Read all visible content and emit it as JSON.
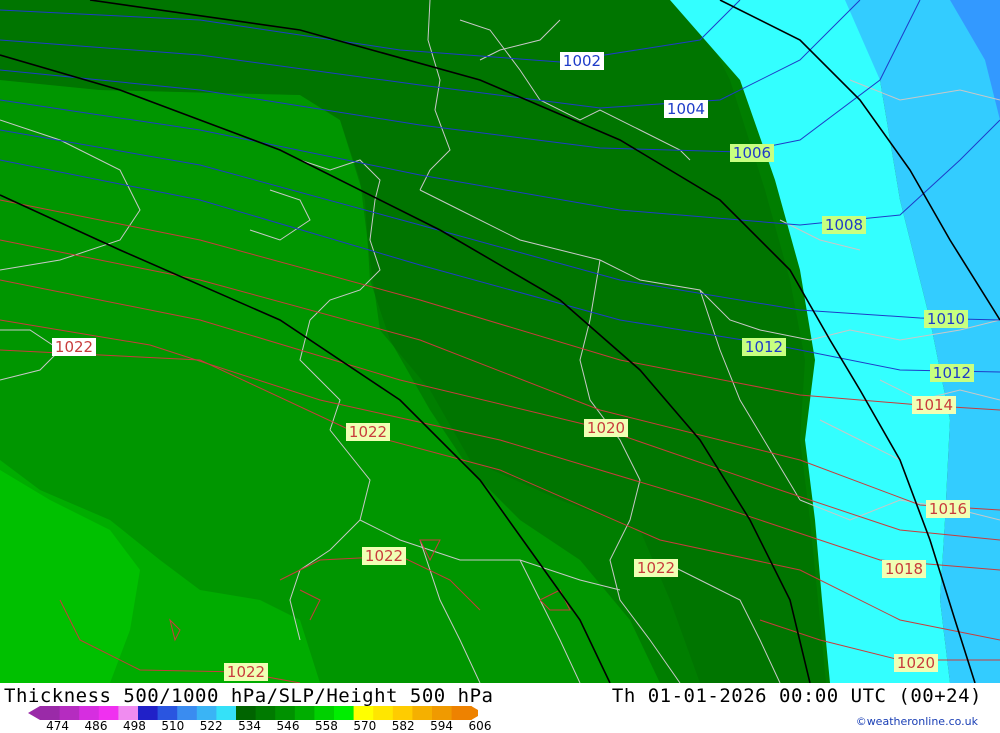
{
  "header": {
    "title": "Thickness 500/1000 hPa/SLP/Height 500 hPa",
    "valid_time": "Th 01-01-2026 00:00 UTC (00+24)",
    "credit": "©weatheronline.co.uk"
  },
  "legend": {
    "ticks": [
      "474",
      "486",
      "498",
      "510",
      "522",
      "534",
      "546",
      "558",
      "570",
      "582",
      "594",
      "606"
    ],
    "colors": [
      "#9a2aa8",
      "#b52cc0",
      "#d62ee0",
      "#f030f0",
      "#f08cf0",
      "#2020c8",
      "#2a55e0",
      "#3a8cf0",
      "#3ab4f5",
      "#35e1f8",
      "#006400",
      "#007a00",
      "#009100",
      "#00ad00",
      "#00d000",
      "#00ee00",
      "#ffff00",
      "#ffe600",
      "#ffcc00",
      "#f5b000",
      "#f09a00",
      "#ee8200"
    ]
  },
  "isobars": {
    "blue": [
      "1002",
      "1004",
      "1006",
      "1008",
      "1010",
      "1012",
      "1012"
    ],
    "red": [
      "1022",
      "1022",
      "1020",
      "1014",
      "1016",
      "1022",
      "1022",
      "1018",
      "1022",
      "1020"
    ]
  },
  "map_colors": {
    "thickness_534": "#007800",
    "thickness_540": "#008c00",
    "thickness_546": "#00a000",
    "thickness_552": "#00b400",
    "thickness_528": "#33ffff",
    "thickness_522": "#33ccff",
    "thickness_516": "#3399ff",
    "isobar_low": "#1428c8",
    "isobar_high": "#c83c3c",
    "height_line": "#000000",
    "border": "#c8c8c8"
  }
}
